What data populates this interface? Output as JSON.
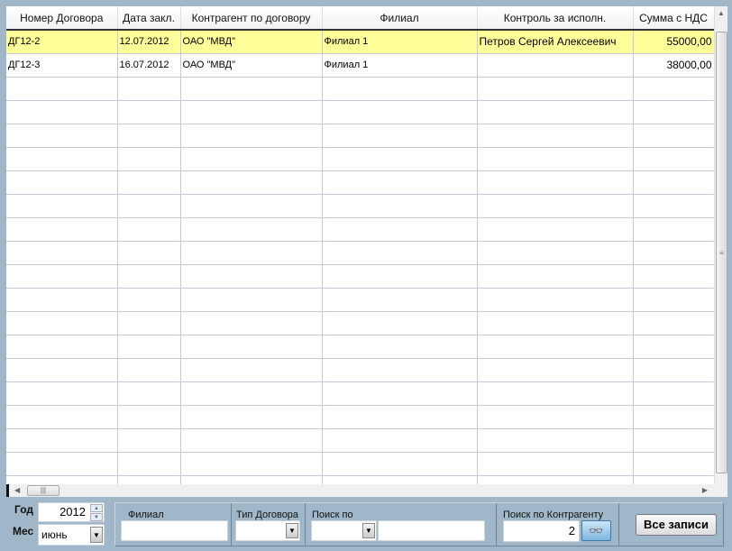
{
  "grid": {
    "columns": [
      "Номер Договора",
      "Дата закл.",
      "Контрагент по договору",
      "Филиал",
      "Контроль за исполн.",
      "Сумма с НДС"
    ],
    "rows": [
      [
        "ДГ12-2",
        "12.07.2012",
        "ОАО \"МВД\"",
        "Филиал 1",
        "Петров Сергей Алексеевич",
        "55000,00"
      ],
      [
        "ДГ12-3",
        "16.07.2012",
        "ОАО \"МВД\"",
        "Филиал 1",
        "",
        "38000,00"
      ]
    ],
    "selected_row": 0,
    "selected_color": "#ffff99"
  },
  "filters": {
    "year_label": "Год",
    "year_value": "2012",
    "month_label": "Мес",
    "month_value": "июнь",
    "branch_label": "Филиал",
    "branch_value": "",
    "contract_type_label": "Тип Договора",
    "contract_type_value": "",
    "search_by_label": "Поиск по",
    "search_by_value": "",
    "search_text": "",
    "search_counterparty_label": "Поиск по Контрагенту",
    "search_counterparty_value": "2",
    "all_records_label": "Все записи"
  }
}
